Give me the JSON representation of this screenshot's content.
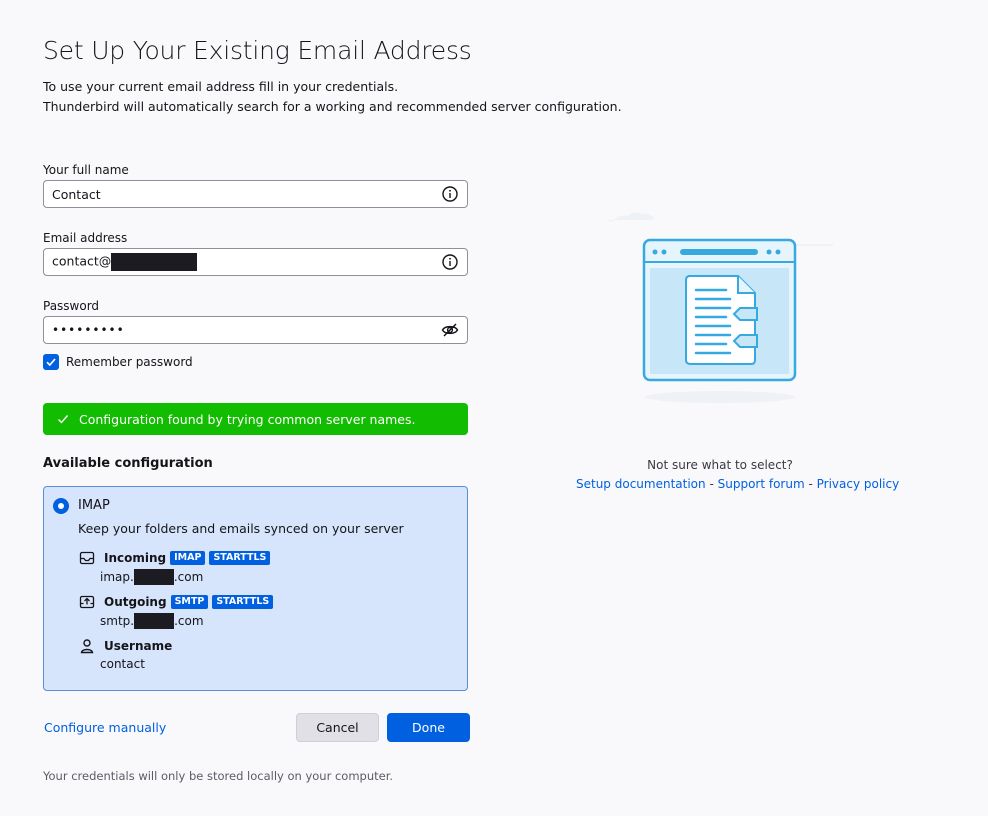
{
  "header": {
    "title": "Set Up Your Existing Email Address",
    "intro_line1": "To use your current email address fill in your credentials.",
    "intro_line2": "Thunderbird will automatically search for a working and recommended server configuration."
  },
  "form": {
    "name_label": "Your full name",
    "name_value": "Contact",
    "email_label": "Email address",
    "email_value": "contact@",
    "password_label": "Password",
    "password_value": "•••••••••",
    "remember_label": "Remember password",
    "remember_checked": true
  },
  "notice": {
    "text": "Configuration found by trying common server names.",
    "color": "#12bc00"
  },
  "config": {
    "section_title": "Available configuration",
    "protocol": "IMAP",
    "description": "Keep your folders and emails synced on your server",
    "incoming_label": "Incoming",
    "incoming_tags": [
      "IMAP",
      "STARTTLS"
    ],
    "incoming_host_prefix": "imap.",
    "incoming_host_suffix": ".com",
    "outgoing_label": "Outgoing",
    "outgoing_tags": [
      "SMTP",
      "STARTTLS"
    ],
    "outgoing_host_prefix": "smtp.",
    "outgoing_host_suffix": ".com",
    "username_label": "Username",
    "username_value": "contact"
  },
  "actions": {
    "configure_manually": "Configure manually",
    "cancel": "Cancel",
    "done": "Done"
  },
  "footer": {
    "text": "Your credentials will only be stored locally on your computer."
  },
  "help": {
    "question": "Not sure what to select?",
    "setup_docs": "Setup documentation",
    "separator": " - ",
    "support_forum": "Support forum",
    "privacy_policy": "Privacy policy"
  },
  "colors": {
    "accent": "#0060df",
    "success": "#12bc00",
    "config_bg": "#d6e5fb"
  }
}
